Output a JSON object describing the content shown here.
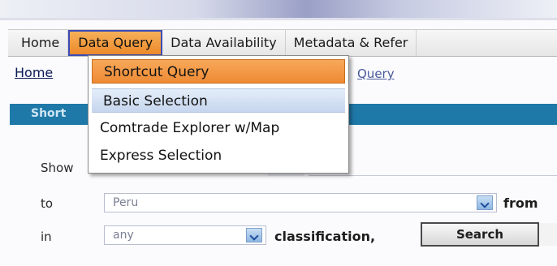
{
  "nav": {
    "items": [
      {
        "label": "Home"
      },
      {
        "label": "Data Query"
      },
      {
        "label": "Data Availability"
      },
      {
        "label": "Metadata & Refer"
      }
    ]
  },
  "breadcrumb": {
    "home": "Home",
    "query": "Query"
  },
  "section": {
    "title": "Short"
  },
  "dropdown": {
    "items": [
      {
        "label": "Shortcut Query"
      },
      {
        "label": "Basic Selection"
      },
      {
        "label": "Comtrade Explorer w/Map"
      },
      {
        "label": "Express Selection"
      }
    ]
  },
  "form": {
    "show_label": "Show",
    "to_label": "to",
    "in_label": "in",
    "to_select": "Peru",
    "in_select": "any",
    "from_label": "from",
    "classification_label": "classification,",
    "search_label": "Search"
  },
  "colors": {
    "nav_active": "#ec8a2a",
    "menu_active": "#ee8a34",
    "section_bar": "#1f79a8"
  }
}
